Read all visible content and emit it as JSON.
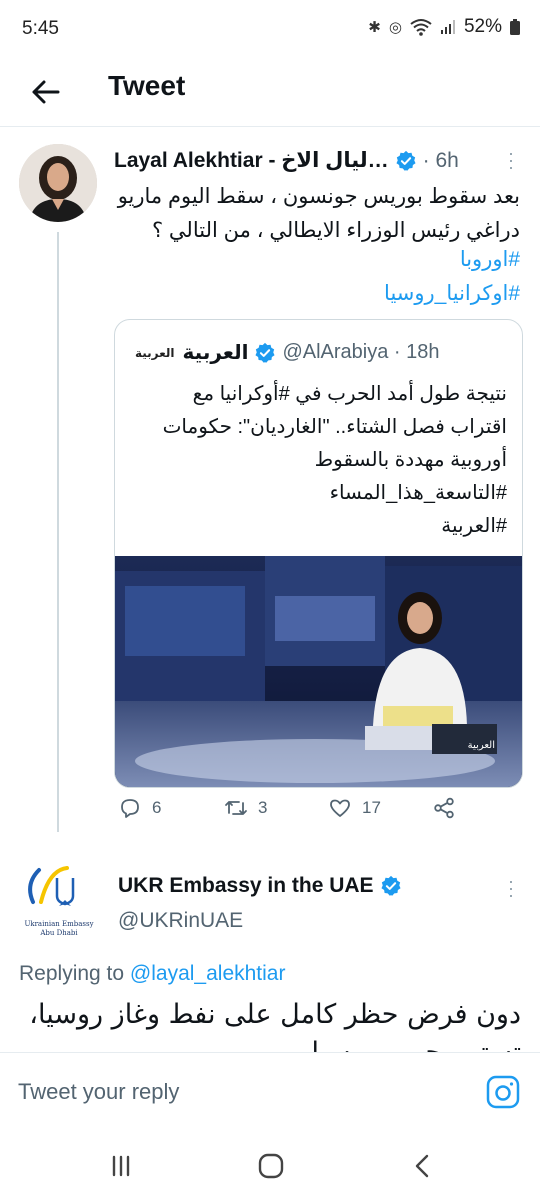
{
  "status_bar": {
    "time": "5:45",
    "battery": "52%"
  },
  "header": {
    "title": "Tweet"
  },
  "tweet": {
    "author_name": "Layal Alekhtiar - ليال الاخ…",
    "time": "· 6h",
    "text": "بعد سقوط بوريس جونسون ، سقط اليوم ماريو دراغي رئيس الوزراء الايطالي ، من التالي ؟",
    "hashtags": [
      "#اوروبا",
      "#اوكرانيا_روسيا"
    ],
    "quote": {
      "logo_text": "العربية",
      "author_name": "العربية",
      "handle_time": "@AlArabiya · 18h",
      "text": "نتيجة طول أمد الحرب في #أوكرانيا مع اقتراب فصل الشتاء.. \"الغارديان\": حكومات أوروبية مهددة بالسقوط",
      "hashtags": [
        "#التاسعة_هذا_المساء",
        "#العربية"
      ],
      "media_logo": "العربية"
    },
    "counts": {
      "replies": "6",
      "retweets": "3",
      "likes": "17"
    }
  },
  "reply_tweet": {
    "author_name": "UKR Embassy in the UAE",
    "handle": "@UKRinUAE",
    "avatar_caption_1": "Ukrainian Embassy",
    "avatar_caption_2": "Abu Dhabi",
    "replying_prefix": "Replying to ",
    "replying_to": "@layal_alekhtiar",
    "text": "دون فرض حظر كامل على نفط وغاز روسيا، تستمر حرب روسيا"
  },
  "composer": {
    "placeholder": "Tweet your reply"
  },
  "colors": {
    "accent": "#1d9bf0",
    "text": "#0f1419",
    "muted": "#536471",
    "border": "#cfd9de"
  },
  "icons": [
    "back-arrow-icon",
    "verified-badge-icon",
    "more-vertical-icon",
    "reply-icon",
    "retweet-icon",
    "like-icon",
    "share-icon",
    "camera-icon",
    "recent-apps-icon",
    "home-icon",
    "nav-back-icon"
  ]
}
